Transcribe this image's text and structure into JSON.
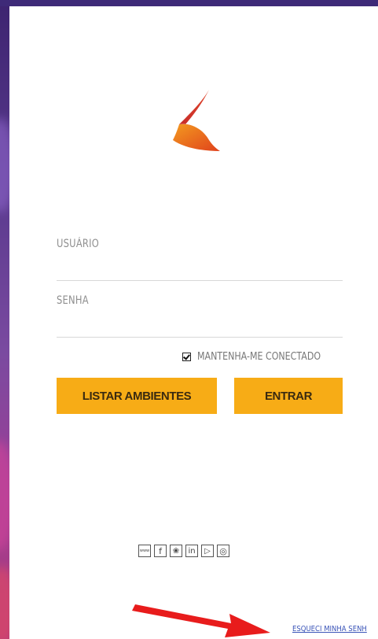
{
  "login": {
    "username_label": "USUÁRIO",
    "password_label": "SENHA",
    "username_value": "",
    "password_value": "",
    "remember_label": "MANTENHA-ME CONECTADO",
    "remember_checked": true,
    "list_button_label": "LISTAR AMBIENTES",
    "enter_button_label": "ENTRAR",
    "forgot_link": "ESQUECI MINHA SENH"
  },
  "social": [
    {
      "icon": "www-icon",
      "glyph": "www"
    },
    {
      "icon": "facebook-icon",
      "glyph": "f"
    },
    {
      "icon": "twitter-icon",
      "glyph": "❀"
    },
    {
      "icon": "linkedin-icon",
      "glyph": "in"
    },
    {
      "icon": "youtube-icon",
      "glyph": "▷"
    },
    {
      "icon": "instagram-icon",
      "glyph": "◎"
    }
  ],
  "colors": {
    "accent": "#f7ac16",
    "link": "#3b55b8",
    "annotation_arrow": "#e81c1c"
  }
}
